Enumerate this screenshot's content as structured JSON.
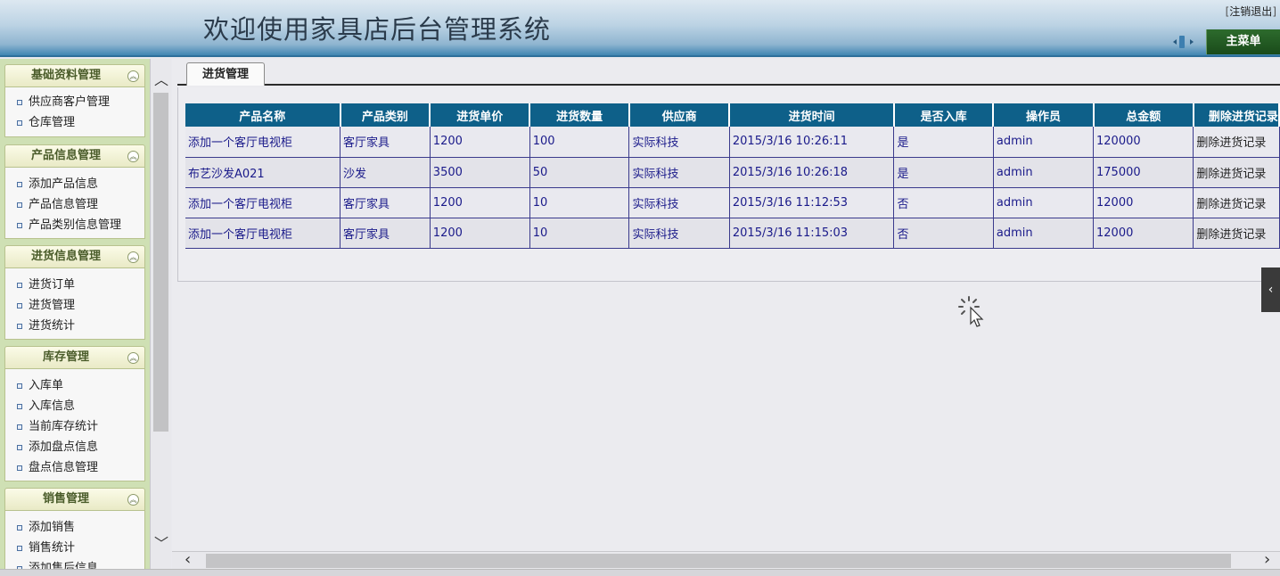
{
  "header": {
    "title": "欢迎使用家具店后台管理系统",
    "logout_label": "注销退出",
    "main_menu_label": "主菜单"
  },
  "sidebar": {
    "groups": [
      {
        "title": "基础资料管理",
        "items": [
          "供应商客户管理",
          "仓库管理"
        ]
      },
      {
        "title": "产品信息管理",
        "items": [
          "添加产品信息",
          "产品信息管理",
          "产品类别信息管理"
        ]
      },
      {
        "title": "进货信息管理",
        "items": [
          "进货订单",
          "进货管理",
          "进货统计"
        ]
      },
      {
        "title": "库存管理",
        "items": [
          "入库单",
          "入库信息",
          "当前库存统计",
          "添加盘点信息",
          "盘点信息管理"
        ]
      },
      {
        "title": "销售管理",
        "items": [
          "添加销售",
          "销售统计",
          "添加售后信息"
        ]
      }
    ]
  },
  "content": {
    "tab_label": "进货管理",
    "table": {
      "headers": [
        "产品名称",
        "产品类别",
        "进货单价",
        "进货数量",
        "供应商",
        "进货时间",
        "是否入库",
        "操作员",
        "总金额",
        "删除进货记录"
      ],
      "rows": [
        [
          "添加一个客厅电视柜",
          "客厅家具",
          "1200",
          "100",
          "实际科技",
          "2015/3/16 10:26:11",
          "是",
          "admin",
          "120000",
          "删除进货记录"
        ],
        [
          "布艺沙发A021",
          "沙发",
          "3500",
          "50",
          "实际科技",
          "2015/3/16 10:26:18",
          "是",
          "admin",
          "175000",
          "删除进货记录"
        ],
        [
          "添加一个客厅电视柜",
          "客厅家具",
          "1200",
          "10",
          "实际科技",
          "2015/3/16 11:12:53",
          "否",
          "admin",
          "12000",
          "删除进货记录"
        ],
        [
          "添加一个客厅电视柜",
          "客厅家具",
          "1200",
          "10",
          "实际科技",
          "2015/3/16 11:15:03",
          "否",
          "admin",
          "12000",
          "删除进货记录"
        ]
      ]
    }
  }
}
